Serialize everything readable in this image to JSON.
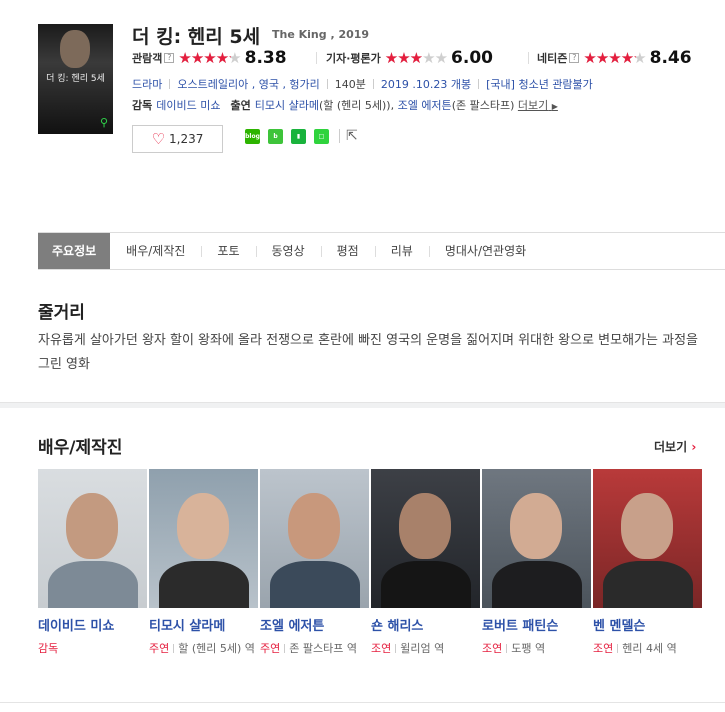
{
  "movie": {
    "title": "더 킹: 헨리 5세",
    "original_title": "The King , 2019",
    "poster_title": "더 킹: 헨리 5세"
  },
  "ratings": [
    {
      "label": "관람객",
      "score": "8.38",
      "fill_fraction": 0.838,
      "help": "?"
    },
    {
      "label": "기자·평론가",
      "score": "6.00",
      "fill_fraction": 0.6
    },
    {
      "label": "네티즌",
      "score": "8.46",
      "fill_fraction": 0.846,
      "help": "?"
    }
  ],
  "meta": {
    "genre": "드라마",
    "countries": "오스트레일리아 , 영국 , 헝가리",
    "runtime": "140분",
    "release": "2019 .10.23 개봉",
    "rating": "[국내] 청소년 관람불가"
  },
  "crew": {
    "director_label": "감독",
    "director": "데이비드 미쇼",
    "cast_label": "출연",
    "cast_1": "티모시 샬라메",
    "cast_1_role": "(할 (헨리 5세)),",
    "cast_2": "조엘 에저튼",
    "cast_2_role": "(존 팔스타프)",
    "more": "더보기"
  },
  "like_count": "1,237",
  "share_icons": [
    "blog",
    "band",
    "kakao-page",
    "line"
  ],
  "tabs": [
    "주요정보",
    "배우/제작진",
    "포토",
    "동영상",
    "평점",
    "리뷰",
    "명대사/연관영화"
  ],
  "synopsis": {
    "title": "줄거리",
    "text": "자유롭게 살아가던 왕자 할이 왕좌에 올라 전쟁으로 혼란에 빠진 영국의 운명을 짊어지며 위대한 왕으로 변모해가는 과정을 그린 영화"
  },
  "cast_section": {
    "title": "배우/제작진",
    "more": "더보기"
  },
  "people": [
    {
      "name": "데이비드 미쇼",
      "kind": "감독",
      "role": ""
    },
    {
      "name": "티모시 샬라메",
      "kind": "주연",
      "role": "할 (헨리 5세) 역"
    },
    {
      "name": "조엘 에저튼",
      "kind": "주연",
      "role": "존 팔스타프 역"
    },
    {
      "name": "숀 해리스",
      "kind": "조연",
      "role": "윌리엄 역"
    },
    {
      "name": "로버트 패틴슨",
      "kind": "조연",
      "role": "도팽 역"
    },
    {
      "name": "벤 멘델슨",
      "kind": "조연",
      "role": "헨리 4세 역"
    }
  ],
  "colors": {
    "accent": "#e51e3e",
    "link": "#2d51a8",
    "tab_active": "#7e7e7e"
  }
}
